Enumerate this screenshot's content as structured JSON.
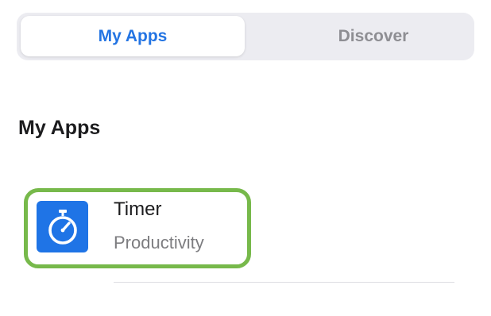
{
  "tabs": [
    {
      "label": "My Apps",
      "selected": true
    },
    {
      "label": "Discover",
      "selected": false
    }
  ],
  "section": {
    "title": "My Apps"
  },
  "apps": [
    {
      "name": "Timer",
      "category": "Productivity",
      "icon": "stopwatch-icon",
      "icon_background": "#1f74e6",
      "highlight_color": "#77b94b"
    }
  ],
  "colors": {
    "accent": "#2374e3",
    "inactive_tab_text": "#8e8e93",
    "segmented_background": "#ececf1"
  }
}
